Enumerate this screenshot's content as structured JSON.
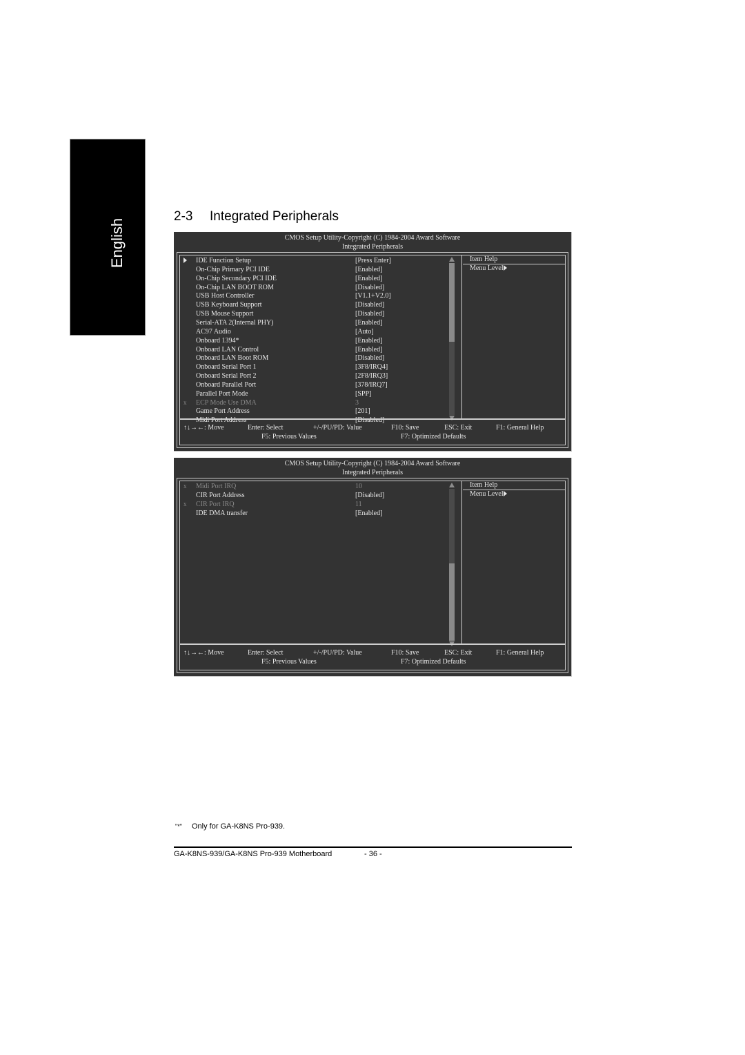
{
  "side_tab": {
    "label": "English"
  },
  "section": {
    "number": "2-3",
    "title": "Integrated Peripherals"
  },
  "screens": [
    {
      "header_line1": "CMOS Setup Utility-Copyright (C) 1984-2004 Award Software",
      "header_line2": "Integrated Peripherals",
      "items": [
        {
          "mark": "submenu-arrow",
          "label": "IDE Function Setup",
          "value": "[Press Enter]",
          "disabled": false
        },
        {
          "mark": "",
          "label": "On-Chip Primary PCI IDE",
          "value": "[Enabled]",
          "disabled": false
        },
        {
          "mark": "",
          "label": "On-Chip Secondary PCI IDE",
          "value": "[Enabled]",
          "disabled": false
        },
        {
          "mark": "",
          "label": "On-Chip LAN BOOT ROM",
          "value": "[Disabled]",
          "disabled": false
        },
        {
          "mark": "",
          "label": "USB Host Controller",
          "value": "[V1.1+V2.0]",
          "disabled": false
        },
        {
          "mark": "",
          "label": "USB Keyboard Support",
          "value": "[Disabled]",
          "disabled": false
        },
        {
          "mark": "",
          "label": "USB Mouse Support",
          "value": "[Disabled]",
          "disabled": false
        },
        {
          "mark": "",
          "label": "Serial-ATA 2(Internal PHY)",
          "value": "[Enabled]",
          "disabled": false
        },
        {
          "mark": "",
          "label": "AC97 Audio",
          "value": "[Auto]",
          "disabled": false
        },
        {
          "mark": "",
          "label": "Onboard 1394*",
          "value": "[Enabled]",
          "disabled": false
        },
        {
          "mark": "",
          "label": "Onboard LAN Control",
          "value": "[Enabled]",
          "disabled": false
        },
        {
          "mark": "",
          "label": "Onboard LAN Boot ROM",
          "value": "[Disabled]",
          "disabled": false
        },
        {
          "mark": "",
          "label": "Onboard Serial Port 1",
          "value": "[3F8/IRQ4]",
          "disabled": false
        },
        {
          "mark": "",
          "label": "Onboard Serial Port 2",
          "value": "[2F8/IRQ3]",
          "disabled": false
        },
        {
          "mark": "",
          "label": "Onboard Parallel Port",
          "value": "[378/IRQ7]",
          "disabled": false
        },
        {
          "mark": "",
          "label": "Parallel Port Mode",
          "value": "[SPP]",
          "disabled": false
        },
        {
          "mark": "x",
          "label": "ECP Mode Use DMA",
          "value": "3",
          "disabled": true
        },
        {
          "mark": "",
          "label": "Game Port Address",
          "value": "[201]",
          "disabled": false
        },
        {
          "mark": "",
          "label": "Midi Port Address",
          "value": "[Disabled]",
          "disabled": false
        }
      ],
      "scroll_position": "top",
      "item_help": {
        "title": "Item Help",
        "menu_level": "Menu Level"
      },
      "footer": {
        "move": "↑↓→←: Move",
        "select": "Enter: Select",
        "value": "+/-/PU/PD: Value",
        "save": "F10: Save",
        "exit": "ESC: Exit",
        "help": "F1: General Help",
        "previous": "F5: Previous Values",
        "defaults": "F7: Optimized Defaults"
      }
    },
    {
      "header_line1": "CMOS Setup Utility-Copyright (C) 1984-2004 Award Software",
      "header_line2": "Integrated Peripherals",
      "items": [
        {
          "mark": "x",
          "label": "Midi Port IRQ",
          "value": "10",
          "disabled": true
        },
        {
          "mark": "",
          "label": "CIR Port Address",
          "value": "[Disabled]",
          "disabled": false
        },
        {
          "mark": "x",
          "label": "CIR Port IRQ",
          "value": "11",
          "disabled": true
        },
        {
          "mark": "",
          "label": "IDE DMA transfer",
          "value": "[Enabled]",
          "disabled": false
        }
      ],
      "scroll_position": "bottom",
      "item_help": {
        "title": "Item Help",
        "menu_level": "Menu Level"
      },
      "footer": {
        "move": "↑↓→←: Move",
        "select": "Enter: Select",
        "value": "+/-/PU/PD: Value",
        "save": "F10: Save",
        "exit": "ESC: Exit",
        "help": "F1: General Help",
        "previous": "F5: Previous Values",
        "defaults": "F7: Optimized Defaults"
      }
    }
  ],
  "footnote": {
    "marker": "\"*\"",
    "text": "Only for GA-K8NS Pro-939."
  },
  "page_footer": {
    "title": "GA-K8NS-939/GA-K8NS Pro-939 Motherboard",
    "page": "- 36 -"
  }
}
